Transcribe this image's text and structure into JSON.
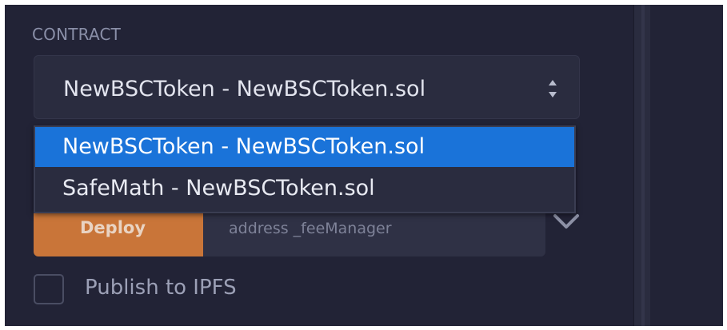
{
  "contract": {
    "section_label": "CONTRACT",
    "selected_value": "NewBSCToken - NewBSCToken.sol",
    "options": [
      "NewBSCToken - NewBSCToken.sol",
      "SafeMath - NewBSCToken.sol"
    ],
    "selected_index": 0
  },
  "deploy": {
    "button_label": "Deploy",
    "input_placeholder": "address _feeManager"
  },
  "publish": {
    "checkbox_label": "Publish to IPFS",
    "checked": false
  },
  "colors": {
    "panel_background": "#222336",
    "option_highlight": "#1a73d9",
    "deploy_button": "#c97539"
  },
  "icons": {
    "select_arrows": "sort-arrows-icon",
    "expand": "chevron-down-icon"
  }
}
